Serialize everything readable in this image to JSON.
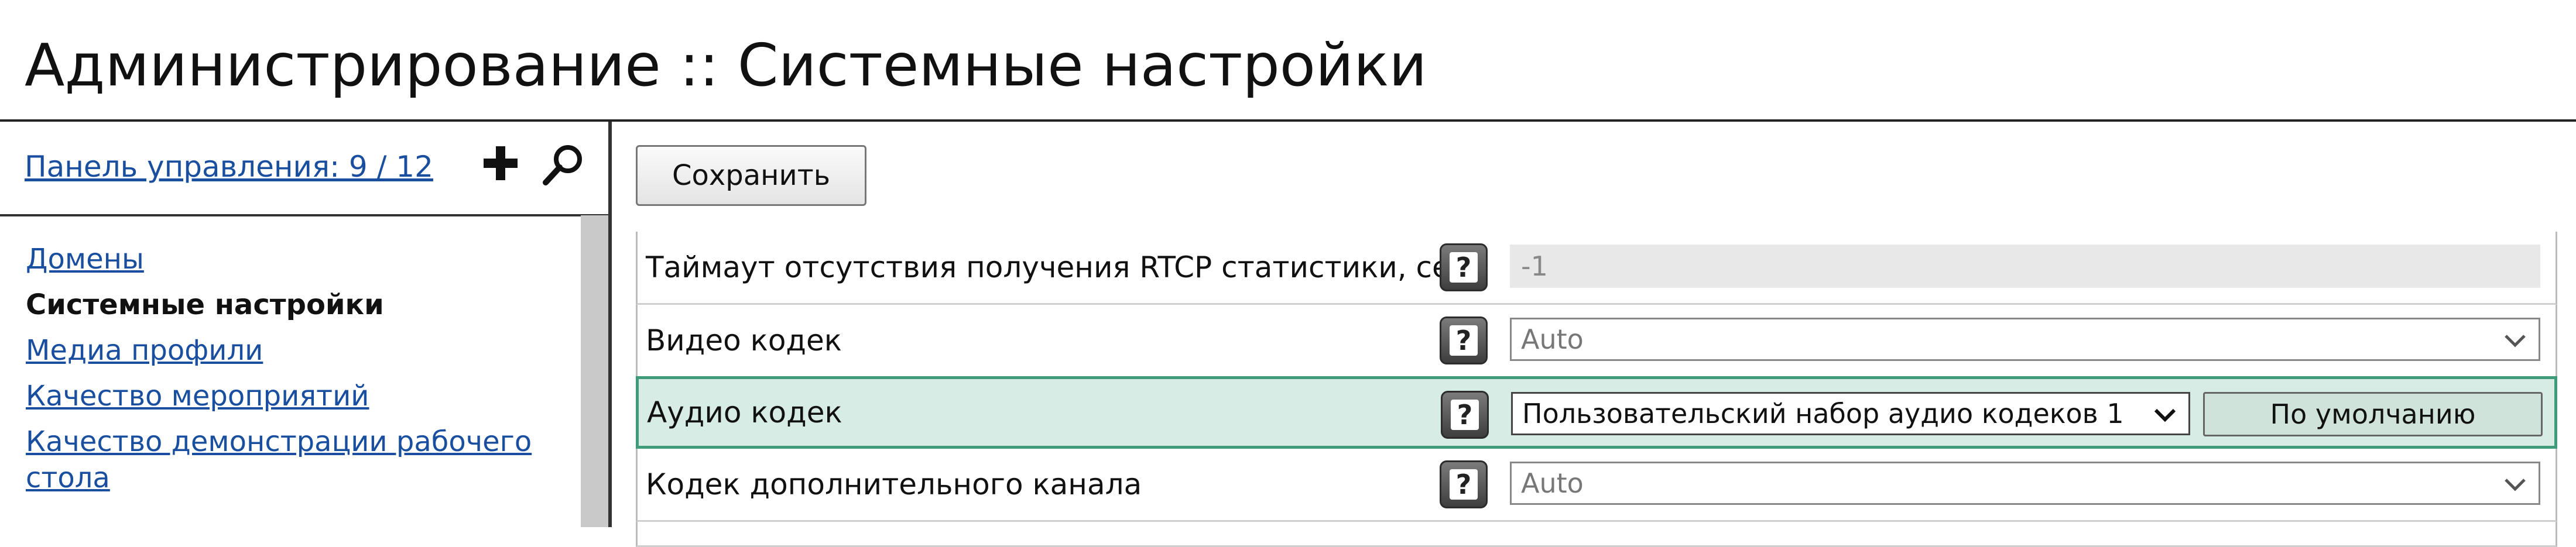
{
  "page": {
    "title": "Администрирование :: Системные настройки"
  },
  "sidebar": {
    "panel_link": "Панель управления: 9 / 12",
    "add_icon": "plus-icon",
    "search_icon": "search-icon",
    "items": [
      {
        "label": "Домены",
        "active": false
      },
      {
        "label": "Системные настройки",
        "active": true
      },
      {
        "label": "Медиа профили",
        "active": false
      },
      {
        "label": "Качество мероприятий",
        "active": false
      },
      {
        "label": "Качество демонстрации рабочего стола",
        "active": false
      }
    ]
  },
  "toolbar": {
    "save_label": "Сохранить"
  },
  "settings": [
    {
      "label": "Таймаут отсутствия получения RTCP статистики, сек.",
      "value": "-1",
      "type": "readonly"
    },
    {
      "label": "Видео кодек",
      "value": "Auto",
      "type": "select"
    },
    {
      "label": "Аудио кодек",
      "value": "Пользовательский набор аудио кодеков 1",
      "type": "select",
      "default_label": "По умолчанию"
    },
    {
      "label": "Кодек дополнительного канала",
      "value": "Auto",
      "type": "select"
    }
  ],
  "help_glyph": "?",
  "colors": {
    "link": "#1a4fa0",
    "highlight_bg": "#d7ece4",
    "highlight_border": "#3f9b7a"
  }
}
